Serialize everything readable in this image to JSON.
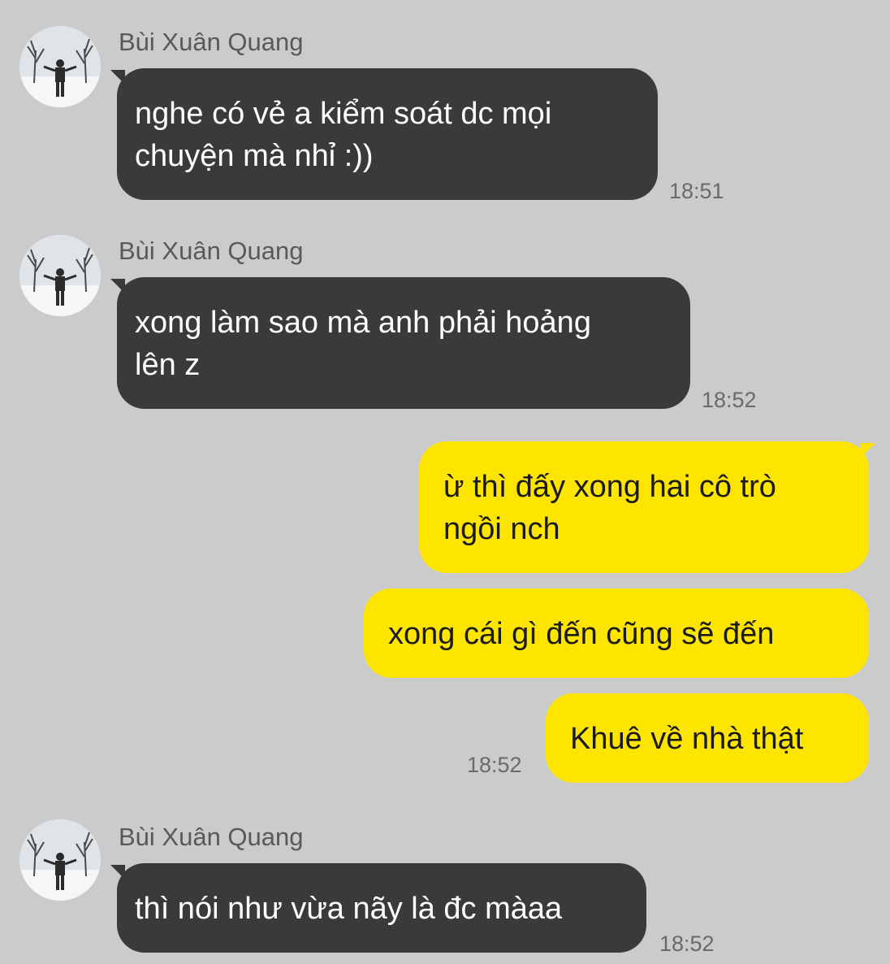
{
  "contact": {
    "name": "Bùi Xuân Quang",
    "avatar_icon": "profile-photo-snowy-trees"
  },
  "colors": {
    "background": "#cbcbcb",
    "incoming_bubble": "#3a3a3c",
    "outgoing_bubble": "#fde500"
  },
  "messages": [
    {
      "sender": "Bùi Xuân Quang",
      "text": "nghe có vẻ a kiểm soát dc mọi\nchuyện mà nhỉ :))",
      "time": "18:51"
    },
    {
      "sender": "Bùi Xuân Quang",
      "text": "xong làm sao mà anh phải hoảng\nlên z",
      "time": "18:52"
    },
    {
      "sender": "me",
      "text": "ừ thì đấy xong hai cô trò\nngồi nch",
      "time": ""
    },
    {
      "sender": "me",
      "text": "xong cái gì đến cũng sẽ đến",
      "time": ""
    },
    {
      "sender": "me",
      "text": "Khuê về nhà thật",
      "time": "18:52"
    },
    {
      "sender": "Bùi Xuân Quang",
      "text": "thì nói như vừa nãy là đc màaa",
      "time": "18:52"
    }
  ]
}
